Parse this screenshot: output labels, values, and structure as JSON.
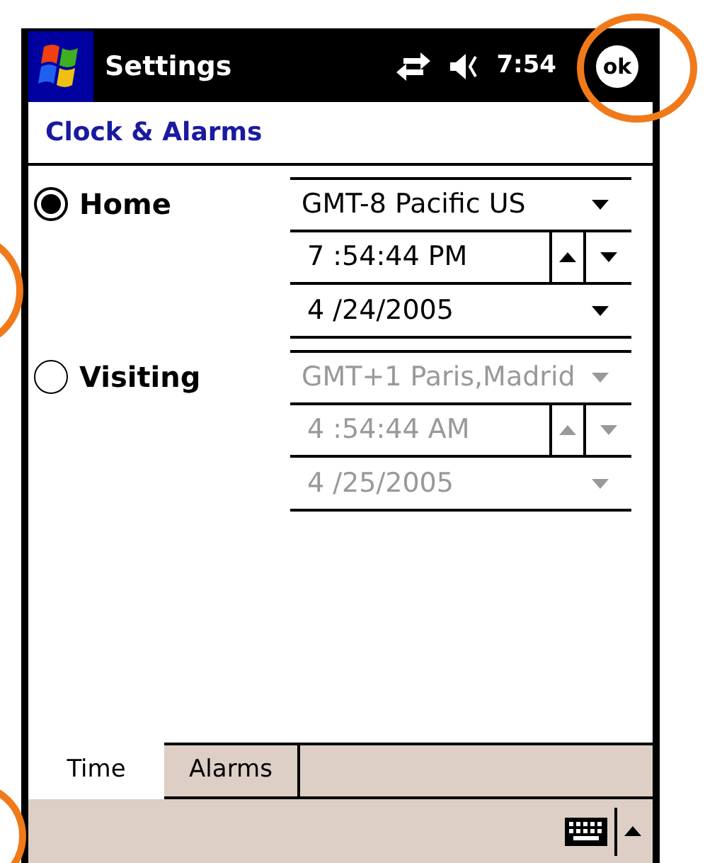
{
  "title_bar": {
    "title": "Settings",
    "time": "7:54",
    "ok": "ok"
  },
  "header": {
    "title": "Clock & Alarms"
  },
  "locations": [
    {
      "label": "Home",
      "selected": true,
      "disabled": false,
      "zone": "GMT-8 Pacific US",
      "time": "7 :54:44 PM",
      "date": "4 /24/2005"
    },
    {
      "label": "Visiting",
      "selected": false,
      "disabled": true,
      "zone": "GMT+1 Paris,Madrid",
      "time": "4 :54:44 AM",
      "date": "4 /25/2005"
    }
  ],
  "tabs": [
    {
      "label": "Time",
      "selected": true
    },
    {
      "label": "Alarms",
      "selected": false
    }
  ]
}
